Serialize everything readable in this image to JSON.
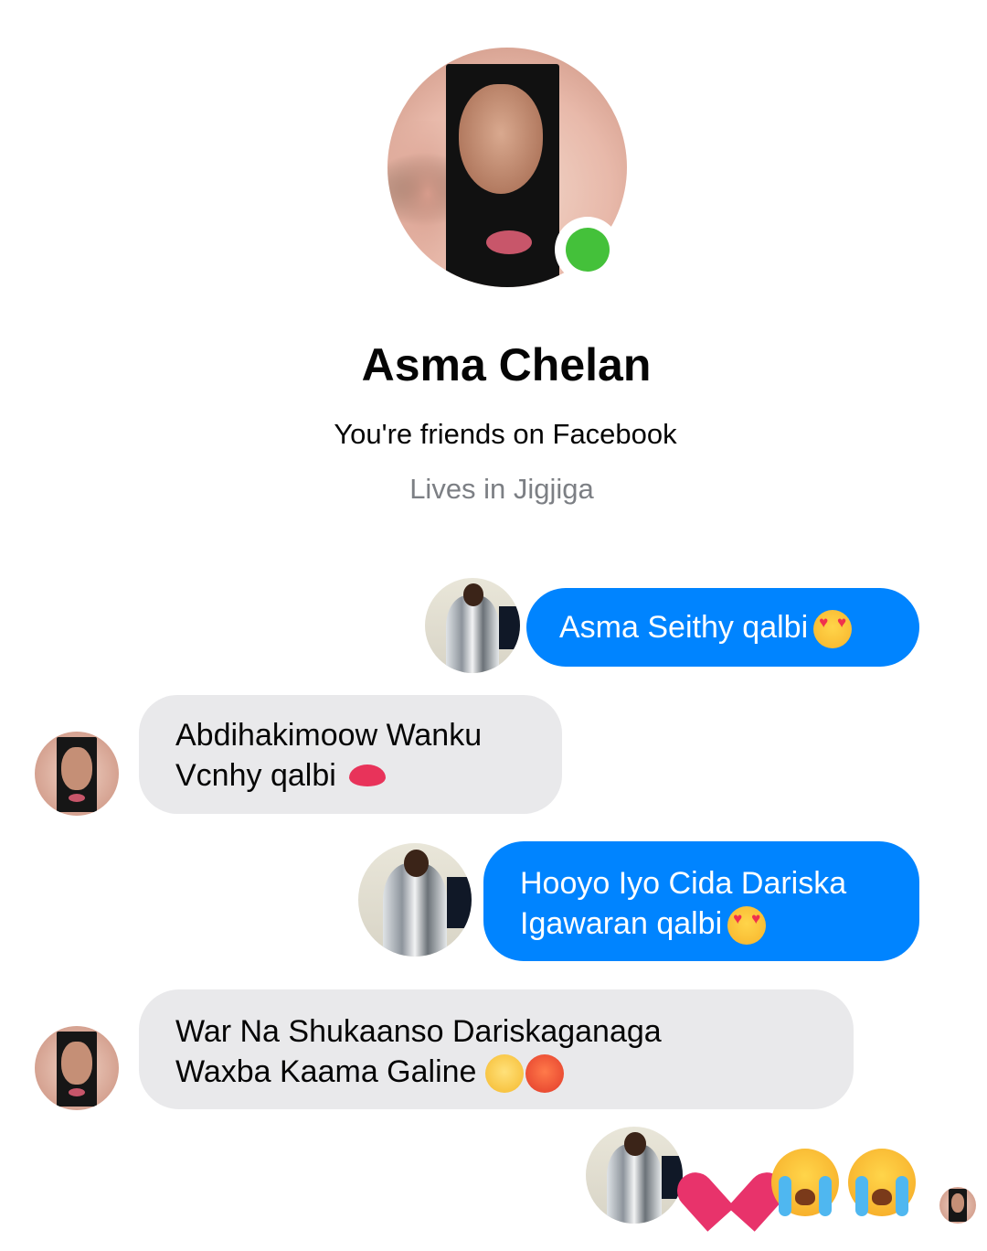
{
  "profile": {
    "name": "Asma Chelan",
    "friend_status": "You're friends on Facebook",
    "location": "Lives in Jigjiga",
    "online": true
  },
  "colors": {
    "outgoing_bubble": "#0084ff",
    "incoming_bubble": "#e9e9eb",
    "online_dot": "#44c13a"
  },
  "messages": [
    {
      "direction": "outgoing",
      "text": "Asma Seithy qalbi",
      "emoji": [
        "smiling-face-with-heart-eyes"
      ]
    },
    {
      "direction": "incoming",
      "lines": [
        "Abdihakimoow Wanku",
        "Vcnhy qalbi"
      ],
      "emoji": [
        "kiss-mark"
      ]
    },
    {
      "direction": "outgoing",
      "lines": [
        "Hooyo Iyo Cida Dariska",
        "Igawaran qalbi"
      ],
      "emoji": [
        "smiling-face-with-heart-eyes"
      ]
    },
    {
      "direction": "incoming",
      "lines": [
        "War Na Shukaanso Dariskaganaga",
        "Waxba Kaama Galine"
      ],
      "emoji": [
        "face-with-rolling-eyes",
        "angry-face"
      ]
    },
    {
      "direction": "outgoing",
      "emoji_only": [
        "broken-heart",
        "loudly-crying-face",
        "loudly-crying-face"
      ]
    }
  ]
}
